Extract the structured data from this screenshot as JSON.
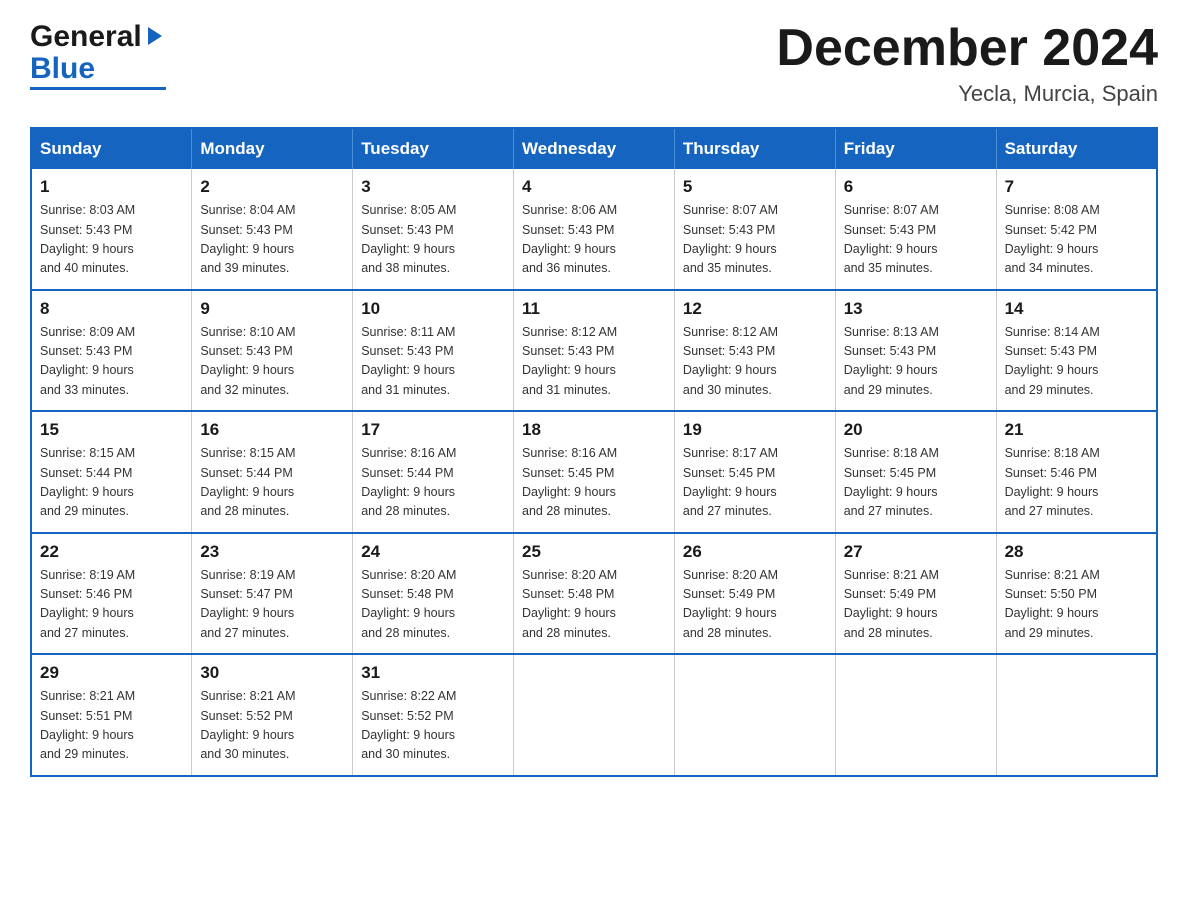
{
  "header": {
    "logo_general": "General",
    "logo_blue": "Blue",
    "month_title": "December 2024",
    "location": "Yecla, Murcia, Spain"
  },
  "weekdays": [
    "Sunday",
    "Monday",
    "Tuesday",
    "Wednesday",
    "Thursday",
    "Friday",
    "Saturday"
  ],
  "weeks": [
    [
      {
        "day": "1",
        "sunrise": "8:03 AM",
        "sunset": "5:43 PM",
        "daylight": "9 hours and 40 minutes."
      },
      {
        "day": "2",
        "sunrise": "8:04 AM",
        "sunset": "5:43 PM",
        "daylight": "9 hours and 39 minutes."
      },
      {
        "day": "3",
        "sunrise": "8:05 AM",
        "sunset": "5:43 PM",
        "daylight": "9 hours and 38 minutes."
      },
      {
        "day": "4",
        "sunrise": "8:06 AM",
        "sunset": "5:43 PM",
        "daylight": "9 hours and 36 minutes."
      },
      {
        "day": "5",
        "sunrise": "8:07 AM",
        "sunset": "5:43 PM",
        "daylight": "9 hours and 35 minutes."
      },
      {
        "day": "6",
        "sunrise": "8:07 AM",
        "sunset": "5:43 PM",
        "daylight": "9 hours and 35 minutes."
      },
      {
        "day": "7",
        "sunrise": "8:08 AM",
        "sunset": "5:42 PM",
        "daylight": "9 hours and 34 minutes."
      }
    ],
    [
      {
        "day": "8",
        "sunrise": "8:09 AM",
        "sunset": "5:43 PM",
        "daylight": "9 hours and 33 minutes."
      },
      {
        "day": "9",
        "sunrise": "8:10 AM",
        "sunset": "5:43 PM",
        "daylight": "9 hours and 32 minutes."
      },
      {
        "day": "10",
        "sunrise": "8:11 AM",
        "sunset": "5:43 PM",
        "daylight": "9 hours and 31 minutes."
      },
      {
        "day": "11",
        "sunrise": "8:12 AM",
        "sunset": "5:43 PM",
        "daylight": "9 hours and 31 minutes."
      },
      {
        "day": "12",
        "sunrise": "8:12 AM",
        "sunset": "5:43 PM",
        "daylight": "9 hours and 30 minutes."
      },
      {
        "day": "13",
        "sunrise": "8:13 AM",
        "sunset": "5:43 PM",
        "daylight": "9 hours and 29 minutes."
      },
      {
        "day": "14",
        "sunrise": "8:14 AM",
        "sunset": "5:43 PM",
        "daylight": "9 hours and 29 minutes."
      }
    ],
    [
      {
        "day": "15",
        "sunrise": "8:15 AM",
        "sunset": "5:44 PM",
        "daylight": "9 hours and 29 minutes."
      },
      {
        "day": "16",
        "sunrise": "8:15 AM",
        "sunset": "5:44 PM",
        "daylight": "9 hours and 28 minutes."
      },
      {
        "day": "17",
        "sunrise": "8:16 AM",
        "sunset": "5:44 PM",
        "daylight": "9 hours and 28 minutes."
      },
      {
        "day": "18",
        "sunrise": "8:16 AM",
        "sunset": "5:45 PM",
        "daylight": "9 hours and 28 minutes."
      },
      {
        "day": "19",
        "sunrise": "8:17 AM",
        "sunset": "5:45 PM",
        "daylight": "9 hours and 27 minutes."
      },
      {
        "day": "20",
        "sunrise": "8:18 AM",
        "sunset": "5:45 PM",
        "daylight": "9 hours and 27 minutes."
      },
      {
        "day": "21",
        "sunrise": "8:18 AM",
        "sunset": "5:46 PM",
        "daylight": "9 hours and 27 minutes."
      }
    ],
    [
      {
        "day": "22",
        "sunrise": "8:19 AM",
        "sunset": "5:46 PM",
        "daylight": "9 hours and 27 minutes."
      },
      {
        "day": "23",
        "sunrise": "8:19 AM",
        "sunset": "5:47 PM",
        "daylight": "9 hours and 27 minutes."
      },
      {
        "day": "24",
        "sunrise": "8:20 AM",
        "sunset": "5:48 PM",
        "daylight": "9 hours and 28 minutes."
      },
      {
        "day": "25",
        "sunrise": "8:20 AM",
        "sunset": "5:48 PM",
        "daylight": "9 hours and 28 minutes."
      },
      {
        "day": "26",
        "sunrise": "8:20 AM",
        "sunset": "5:49 PM",
        "daylight": "9 hours and 28 minutes."
      },
      {
        "day": "27",
        "sunrise": "8:21 AM",
        "sunset": "5:49 PM",
        "daylight": "9 hours and 28 minutes."
      },
      {
        "day": "28",
        "sunrise": "8:21 AM",
        "sunset": "5:50 PM",
        "daylight": "9 hours and 29 minutes."
      }
    ],
    [
      {
        "day": "29",
        "sunrise": "8:21 AM",
        "sunset": "5:51 PM",
        "daylight": "9 hours and 29 minutes."
      },
      {
        "day": "30",
        "sunrise": "8:21 AM",
        "sunset": "5:52 PM",
        "daylight": "9 hours and 30 minutes."
      },
      {
        "day": "31",
        "sunrise": "8:22 AM",
        "sunset": "5:52 PM",
        "daylight": "9 hours and 30 minutes."
      },
      null,
      null,
      null,
      null
    ]
  ]
}
